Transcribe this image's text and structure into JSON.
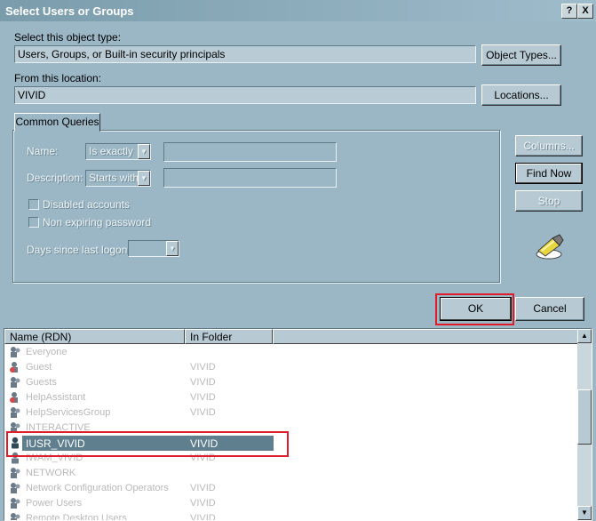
{
  "window": {
    "title": "Select Users or Groups",
    "help_btn": "?",
    "close_btn": "X"
  },
  "object_type": {
    "label": "Select this object type:",
    "value": "Users, Groups, or Built-in security principals",
    "button": "Object Types..."
  },
  "location": {
    "label": "From this location:",
    "value": "VIVID",
    "button": "Locations..."
  },
  "queries": {
    "tab": "Common Queries",
    "name_label": "Name:",
    "name_mode": "Is exactly",
    "desc_label": "Description:",
    "desc_mode": "Starts with",
    "disabled_accounts": "Disabled accounts",
    "non_expiring": "Non expiring password",
    "days_label": "Days since last logon:"
  },
  "side_buttons": {
    "columns": "Columns...",
    "find_now": "Find Now",
    "stop": "Stop"
  },
  "dialog_buttons": {
    "ok": "OK",
    "cancel": "Cancel"
  },
  "results": {
    "columns": [
      "Name (RDN)",
      "In Folder"
    ],
    "rows": [
      {
        "name": "Everyone",
        "folder": ""
      },
      {
        "name": "Guest",
        "folder": "VIVID"
      },
      {
        "name": "Guests",
        "folder": "VIVID"
      },
      {
        "name": "HelpAssistant",
        "folder": "VIVID"
      },
      {
        "name": "HelpServicesGroup",
        "folder": "VIVID"
      },
      {
        "name": "INTERACTIVE",
        "folder": ""
      },
      {
        "name": "IUSR_VIVID",
        "folder": "VIVID",
        "selected": true
      },
      {
        "name": "IWAM_VIVID",
        "folder": "VIVID"
      },
      {
        "name": "NETWORK",
        "folder": ""
      },
      {
        "name": "Network Configuration Operators",
        "folder": "VIVID"
      },
      {
        "name": "Power Users",
        "folder": "VIVID"
      },
      {
        "name": "Remote Desktop Users",
        "folder": "VIVID"
      }
    ]
  },
  "colors": {
    "highlight": "#e01b2a",
    "selection": "#5f7f8f",
    "dialog_bg": "#9bb6c4"
  }
}
